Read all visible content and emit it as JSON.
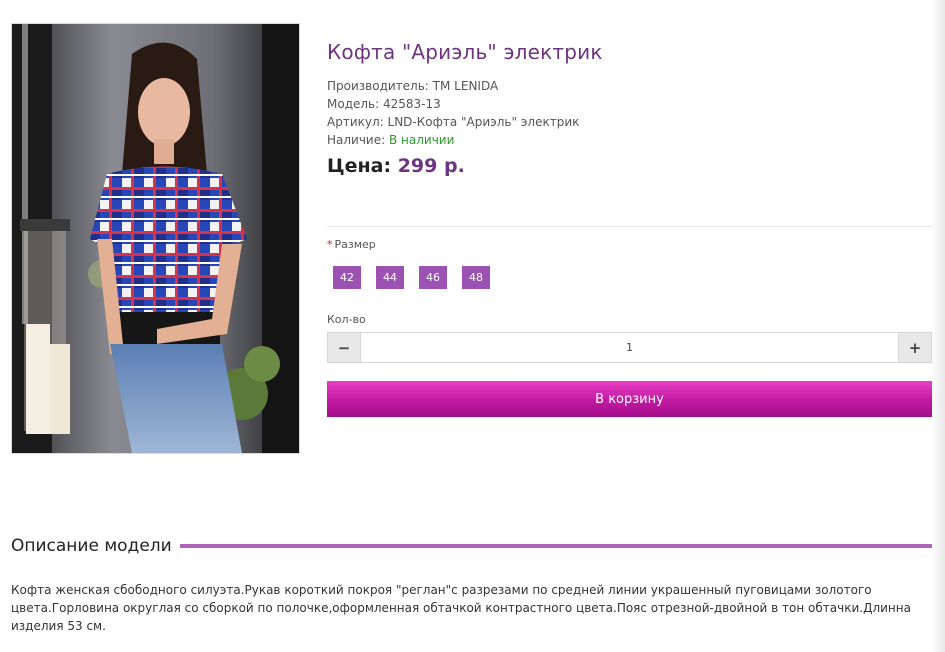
{
  "product": {
    "title": "Кофта \"Ариэль\" электрик",
    "manufacturer_label": "Производитель:",
    "manufacturer": "TM LENIDA",
    "model_label": "Модель:",
    "model": "42583-13",
    "sku_label": "Артикул:",
    "sku": "LND-Кофта \"Ариэль\" электрик",
    "availability_label": "Наличие:",
    "availability": "В наличии",
    "price_label": "Цена:",
    "price": "299 р."
  },
  "options": {
    "required_mark": "*",
    "size_label": "Размер",
    "sizes": [
      "42",
      "44",
      "46",
      "48"
    ],
    "qty_label": "Кол-во",
    "qty_minus": "−",
    "qty_value": "1",
    "qty_plus": "+"
  },
  "cart": {
    "label": "В корзину"
  },
  "description": {
    "title": "Описание модели",
    "text": "Кофта женская сбободного силуэта.Рукав короткий покроя \"реглан\"с разрезами по средней линии украшенный пуговицами золотого цвета.Горловина округлая со сборкой по полочке,оформленная обтачкой контрастного цвета.Пояс отрезной-двойной в тон обтачки.Длинна изделия 53 см."
  },
  "colors": {
    "title": "#6d3480",
    "accent": "#9b52b2",
    "cart_button": "#c11aa2",
    "in_stock": "#2a9a2a"
  }
}
